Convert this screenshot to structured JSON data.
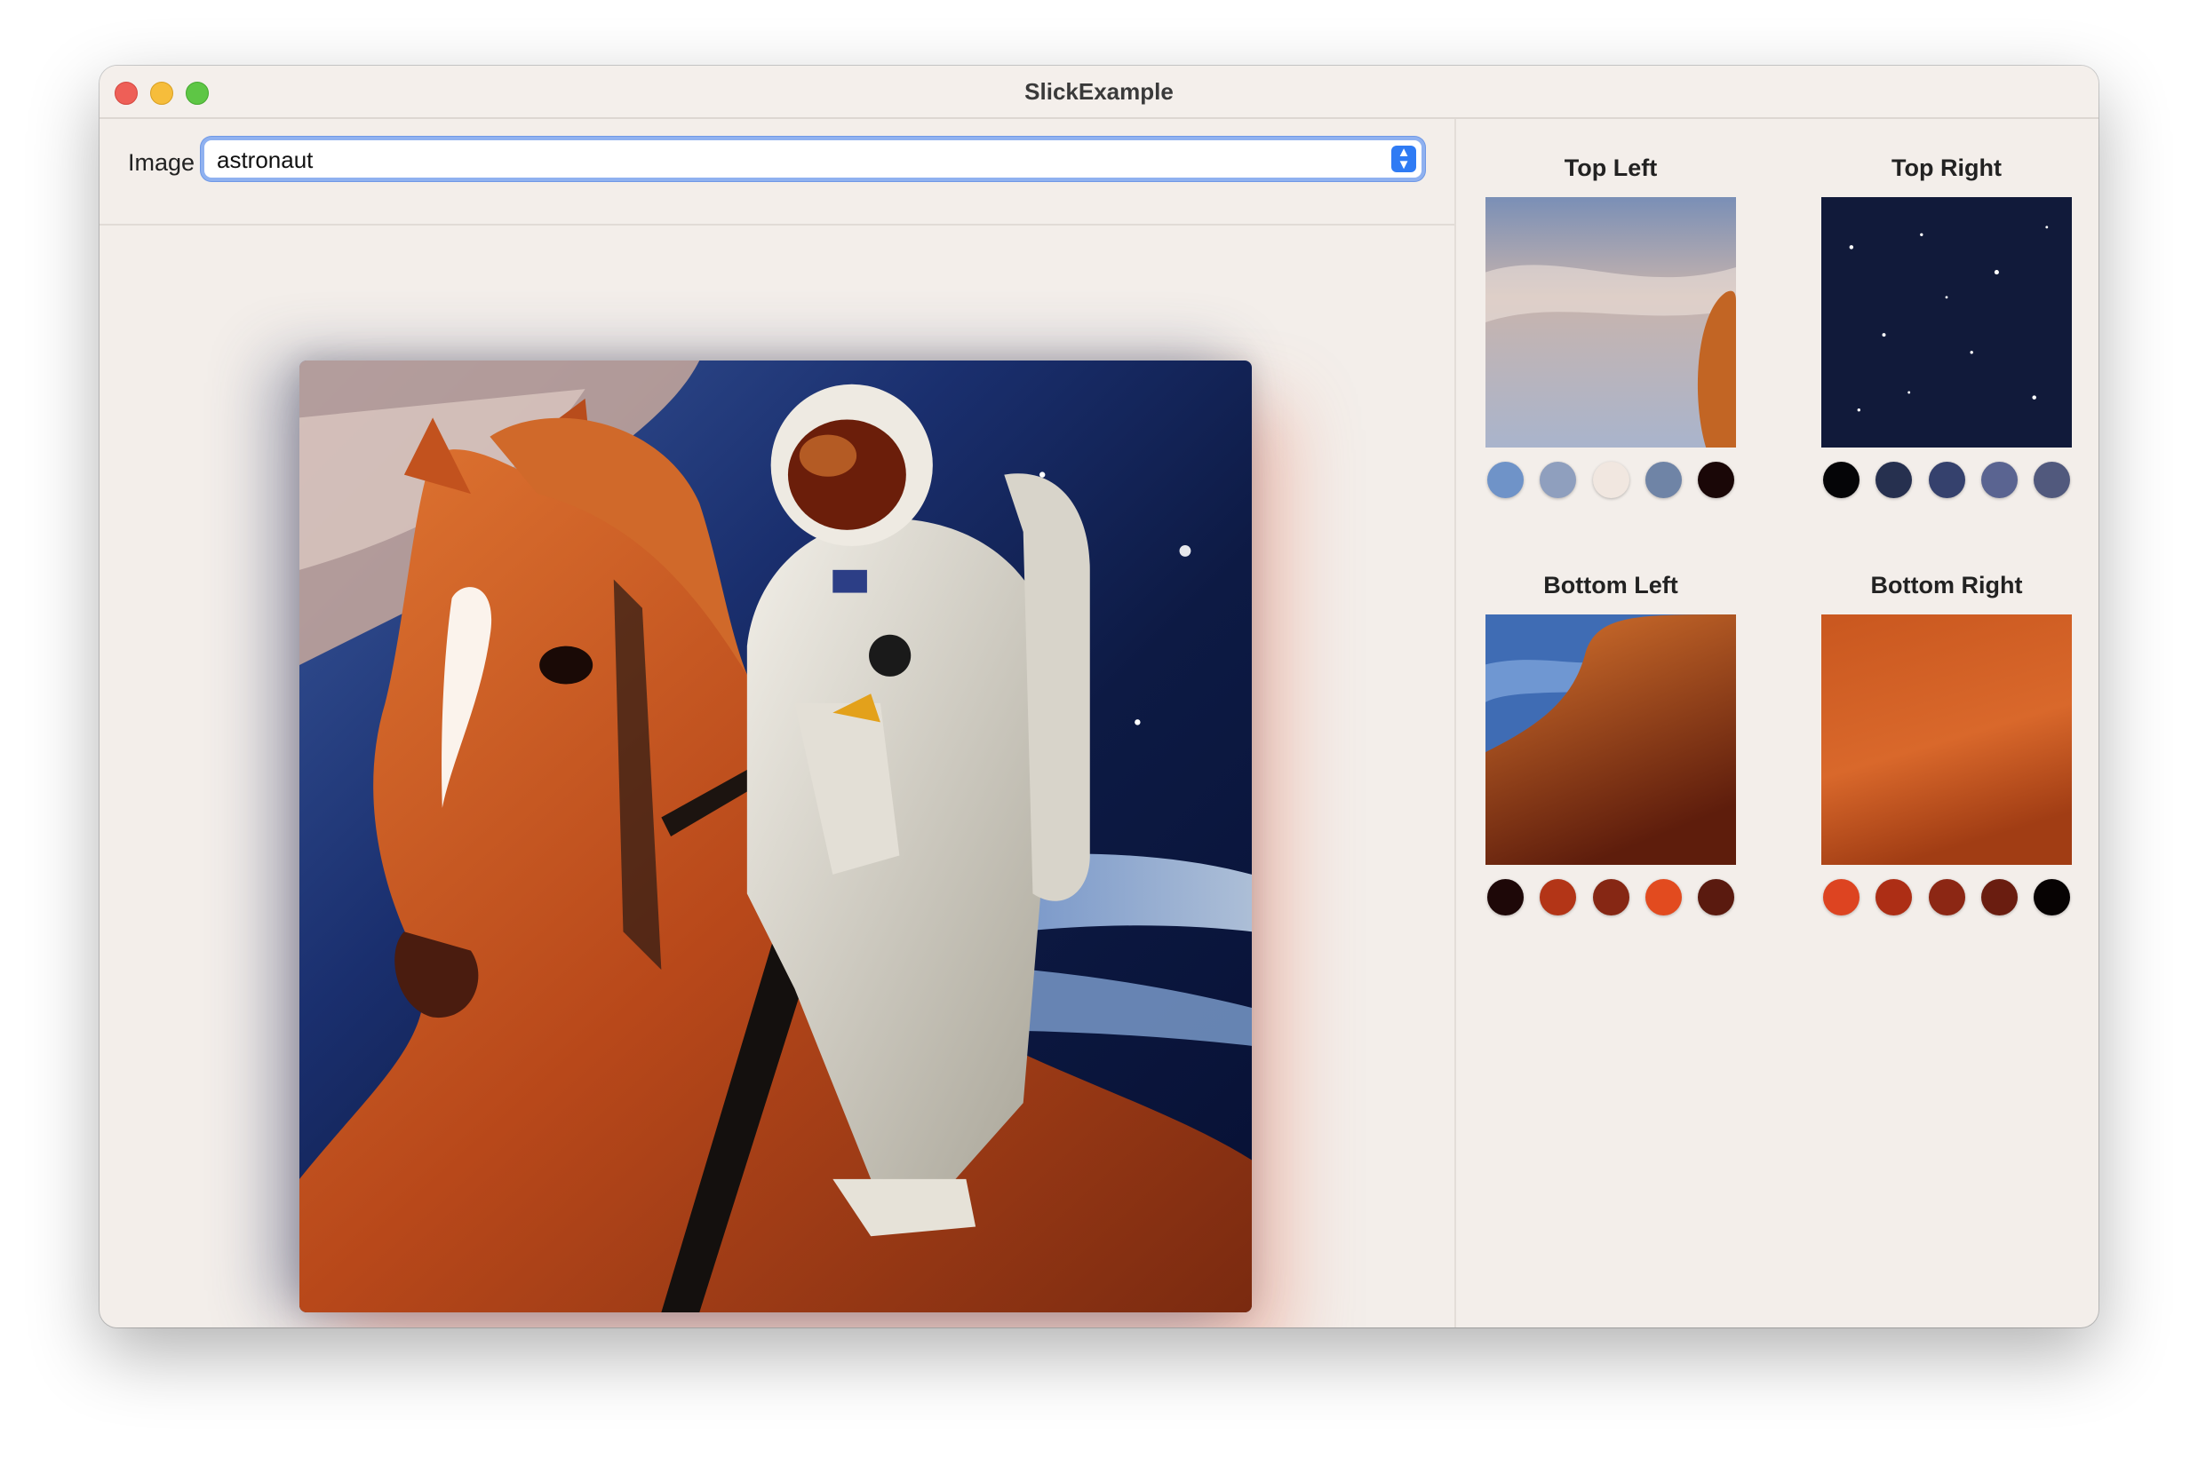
{
  "window": {
    "title": "SlickExample"
  },
  "toolbar": {
    "image_label": "Image",
    "image_select_value": "astronaut"
  },
  "quadrants": [
    {
      "title": "Top Left",
      "palette": [
        "#6f93c8",
        "#8f9fbe",
        "#f1e7e0",
        "#6f84a6",
        "#1a0707"
      ]
    },
    {
      "title": "Top Right",
      "palette": [
        "#050507",
        "#26304f",
        "#35416d",
        "#5a6491",
        "#51597d"
      ]
    },
    {
      "title": "Bottom Left",
      "palette": [
        "#1e0808",
        "#b33517",
        "#862714",
        "#e24b1f",
        "#5a1a0f"
      ]
    },
    {
      "title": "Bottom Right",
      "palette": [
        "#dd4421",
        "#ad2e15",
        "#8c2714",
        "#6a1d10",
        "#070303"
      ]
    }
  ]
}
